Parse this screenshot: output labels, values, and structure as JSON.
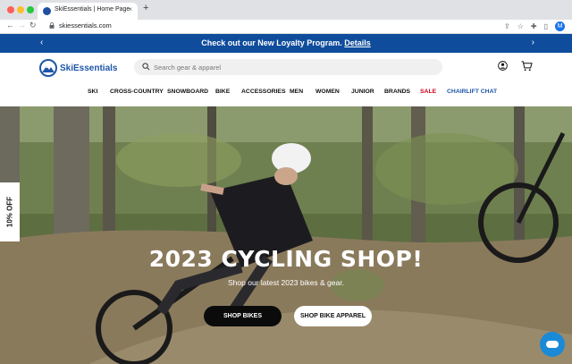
{
  "browser": {
    "tab_title": "SkiEssentials | Home Page",
    "tab_close": "×",
    "new_tab": "+",
    "url": "skiessentials.com",
    "profile_initial": "M"
  },
  "promo": {
    "text": "Check out our New Loyalty Program.",
    "link": "Details",
    "prev": "‹",
    "next": "›"
  },
  "header": {
    "logo_text": "SkiEssentials",
    "search_placeholder": "Search gear & apparel"
  },
  "nav": {
    "items": [
      "SKI",
      "CROSS-COUNTRY",
      "SNOWBOARD",
      "BIKE",
      "ACCESSORIES",
      "MEN",
      "WOMEN",
      "JUNIOR",
      "BRANDS",
      "SALE",
      "CHAIRLIFT CHAT"
    ]
  },
  "hero": {
    "side_badge": "10% OFF",
    "title": "2023 CYCLING SHOP!",
    "subtitle": "Shop our latest 2023 bikes & gear.",
    "btn_primary": "SHOP BIKES",
    "btn_secondary": "SHOP BIKE APPAREL"
  },
  "colors": {
    "brand_blue": "#0f4c9c",
    "sale_red": "#d0021b",
    "chairlift_blue": "#1e56a8",
    "chat_blue": "#1a8ad6"
  },
  "icons": [
    "back-icon",
    "forward-icon",
    "reload-icon",
    "lock-icon",
    "share-icon",
    "star-icon",
    "extensions-icon",
    "sidebar-icon",
    "search-icon",
    "account-icon",
    "cart-icon",
    "chat-icon"
  ]
}
